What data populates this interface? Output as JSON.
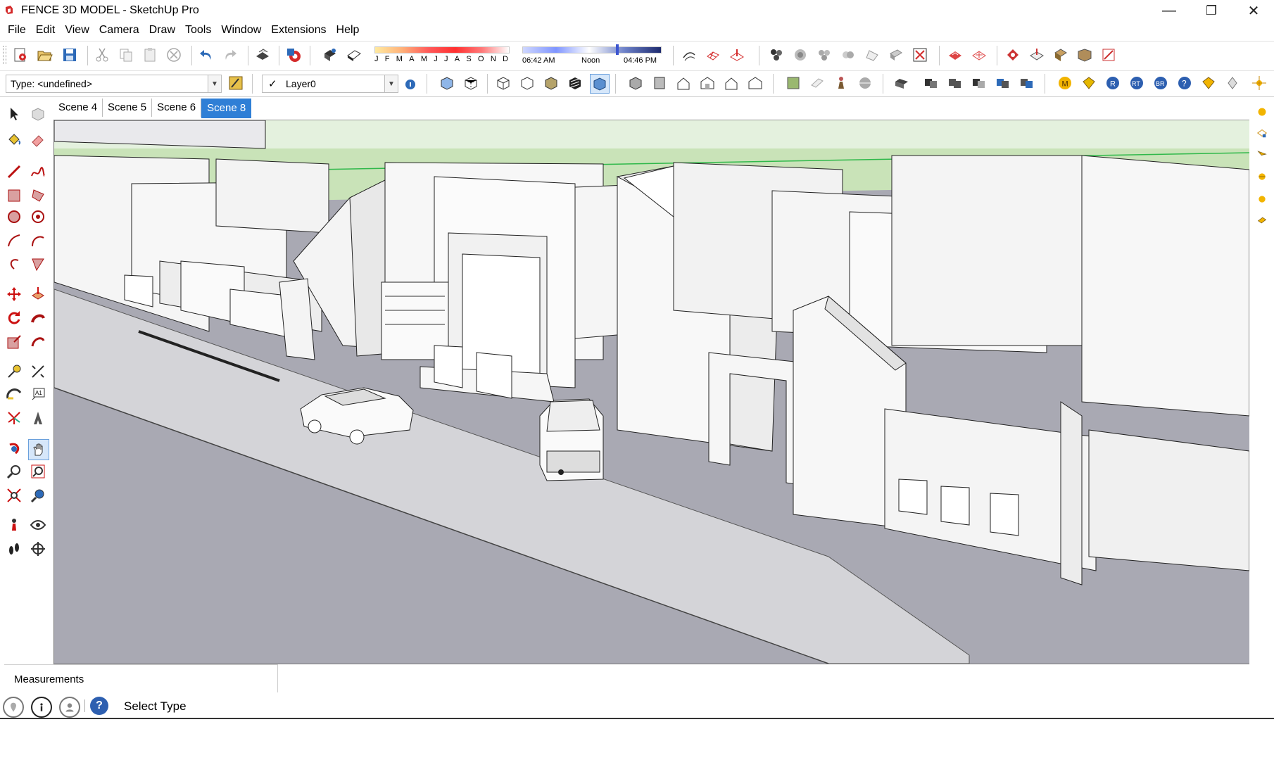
{
  "window": {
    "title": "FENCE 3D MODEL - SketchUp Pro",
    "controls": {
      "minimize": "—",
      "restore": "❐",
      "close": "✕"
    }
  },
  "menu": [
    "File",
    "Edit",
    "View",
    "Camera",
    "Draw",
    "Tools",
    "Window",
    "Extensions",
    "Help"
  ],
  "shadows": {
    "months": [
      "J",
      "F",
      "M",
      "A",
      "M",
      "J",
      "J",
      "A",
      "S",
      "O",
      "N",
      "D"
    ],
    "sunrise": "06:42 AM",
    "noon": "Noon",
    "sunset": "04:46 PM"
  },
  "entity_info": {
    "type_value": "Type: <undefined>",
    "layer_value": "Layer0"
  },
  "scenes": {
    "tabs": [
      "Scene 4",
      "Scene 5",
      "Scene 6",
      "Scene 8"
    ],
    "active": "Scene 8"
  },
  "measurements": {
    "label": "Measurements",
    "value": ""
  },
  "status": {
    "text": "Select Type"
  },
  "colors": {
    "accent": "#2f7fd6",
    "sky": "#c9e3b8",
    "ground": "#a9a9b2",
    "building": "#f7f7f7"
  },
  "icons": {
    "main_toolbar": [
      "new-file-icon",
      "open-icon",
      "save-icon",
      "cut-icon",
      "copy-icon",
      "paste-icon",
      "erase-icon",
      "undo-icon",
      "redo-icon",
      "print-icon",
      "model-info-icon"
    ],
    "left_tools": [
      "select-icon",
      "make-component-icon",
      "paint-bucket-icon",
      "eraser-icon",
      "line-icon",
      "freehand-icon",
      "rectangle-icon",
      "rotated-rectangle-icon",
      "circle-icon",
      "polygon-icon",
      "arc-icon",
      "2-point-arc-icon",
      "3-point-arc-icon",
      "pie-icon",
      "move-icon",
      "push-pull-icon",
      "rotate-icon",
      "follow-me-icon",
      "scale-icon",
      "offset-icon",
      "tape-measure-icon",
      "dimension-icon",
      "protractor-icon",
      "text-icon",
      "axes-icon",
      "3d-text-icon",
      "orbit-icon",
      "pan-icon",
      "zoom-icon",
      "zoom-window-icon",
      "zoom-extents-icon",
      "previous-view-icon",
      "position-camera-icon",
      "look-around-icon",
      "walk-icon",
      "section-plane-icon"
    ]
  }
}
